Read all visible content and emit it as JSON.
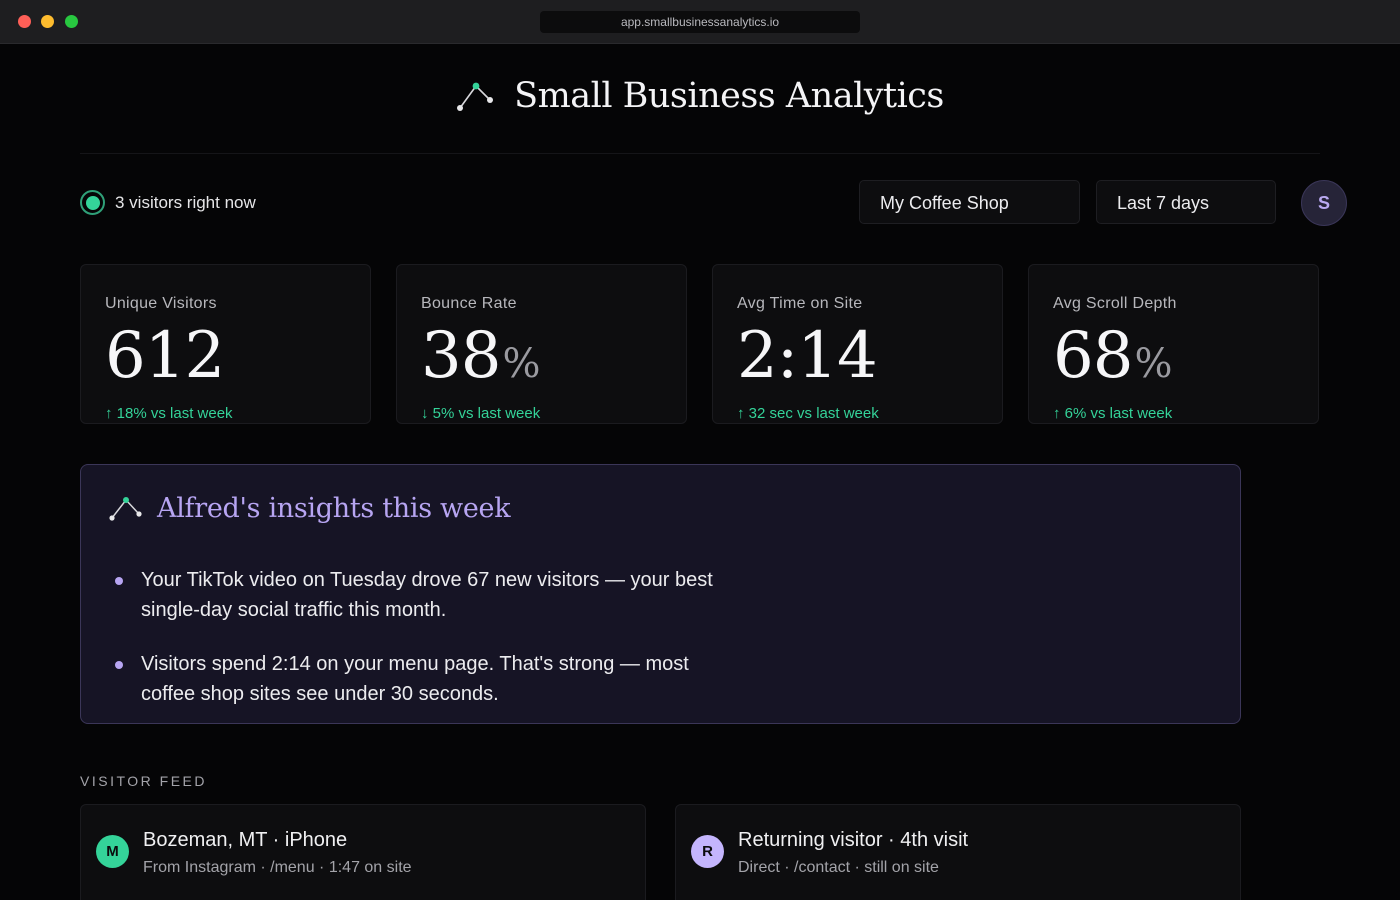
{
  "browser": {
    "url": "app.smallbusinessanalytics.io"
  },
  "header": {
    "title": "Small Business Analytics",
    "logo_icon": "line-chart-logo-icon"
  },
  "toolbar": {
    "live_text": "3 visitors right now",
    "site_select": "My Coffee Shop",
    "range_select": "Last 7 days",
    "avatar_initial": "S"
  },
  "stats": [
    {
      "label": "Unique Visitors",
      "value": "612",
      "unit": "",
      "delta": "↑ 18% vs last week"
    },
    {
      "label": "Bounce Rate",
      "value": "38",
      "unit": "%",
      "delta": "↓ 5% vs last week"
    },
    {
      "label": "Avg Time on Site",
      "value": "2:14",
      "unit": "",
      "delta": "↑ 32 sec vs last week"
    },
    {
      "label": "Avg Scroll Depth",
      "value": "68",
      "unit": "%",
      "delta": "↑ 6% vs last week"
    }
  ],
  "insights": {
    "title": "Alfred's insights this week",
    "items": [
      "Your TikTok video on Tuesday drove 67 new visitors — your best single-day social traffic this month.",
      "Visitors spend 2:14 on your menu page. That's strong — most coffee shop sites see under 30 seconds."
    ]
  },
  "feed": {
    "label": "VISITOR FEED",
    "items": [
      {
        "initial": "M",
        "title": "Bozeman, MT · iPhone",
        "subtitle": "From Instagram · /menu · 1:47 on site"
      },
      {
        "initial": "R",
        "title": "Returning visitor · 4th visit",
        "subtitle": "Direct · /contact · still on site"
      }
    ]
  },
  "colors": {
    "accent_green": "#34d399",
    "accent_purple": "#b7a5f2",
    "background": "#050506"
  }
}
